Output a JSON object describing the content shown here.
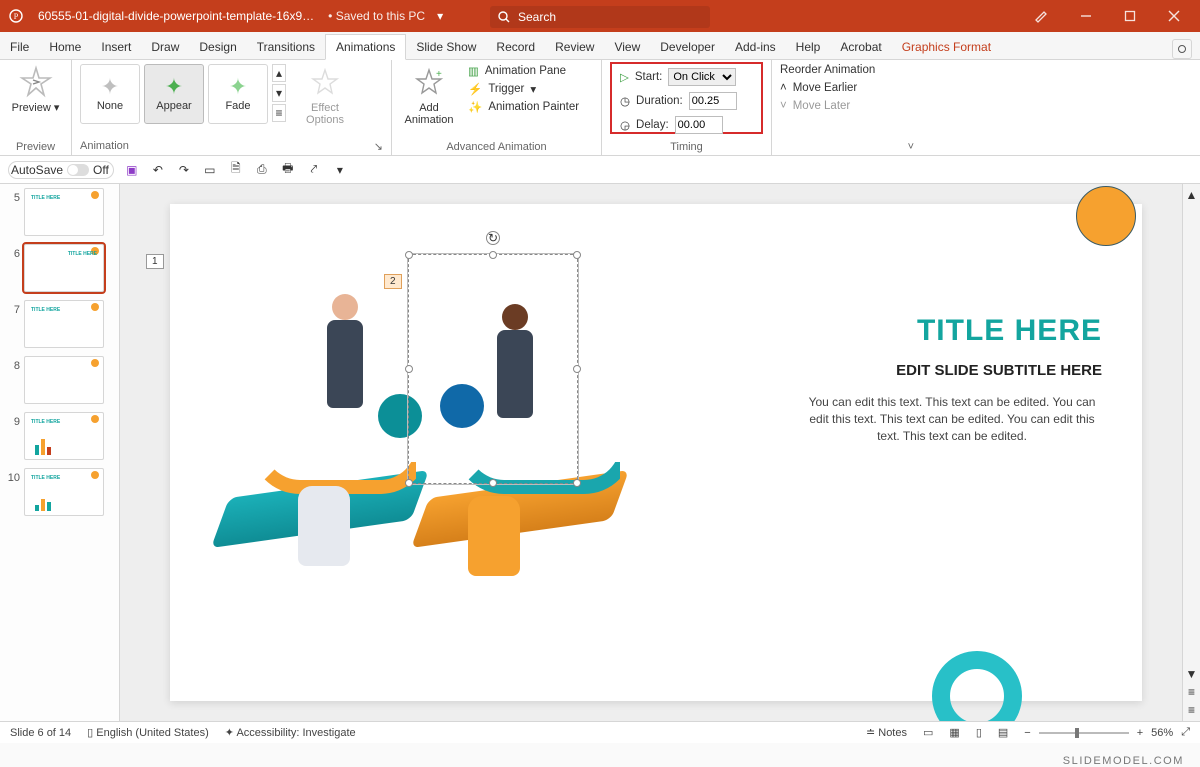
{
  "title": {
    "document": "60555-01-digital-divide-powerpoint-template-16x9…",
    "save_state": "• Saved to this PC",
    "search_placeholder": "Search"
  },
  "tabs": [
    "File",
    "Home",
    "Insert",
    "Draw",
    "Design",
    "Transitions",
    "Animations",
    "Slide Show",
    "Record",
    "Review",
    "View",
    "Developer",
    "Add-ins",
    "Help",
    "Acrobat",
    "Graphics Format"
  ],
  "tabs_active_index": 6,
  "ribbon": {
    "preview": {
      "label": "Preview",
      "group": "Preview"
    },
    "animation": {
      "group": "Animation",
      "items": [
        {
          "name": "None",
          "color": "#bfbfbf"
        },
        {
          "name": "Appear",
          "color": "#4caf50",
          "selected": true
        },
        {
          "name": "Fade",
          "color": "#4caf50"
        }
      ],
      "effect_options": "Effect\nOptions"
    },
    "advanced": {
      "group": "Advanced Animation",
      "add": "Add\nAnimation",
      "pane": "Animation Pane",
      "trigger": "Trigger",
      "painter": "Animation Painter"
    },
    "timing": {
      "group": "Timing",
      "start_label": "Start:",
      "start_value": "On Click",
      "duration_label": "Duration:",
      "duration_value": "00.25",
      "delay_label": "Delay:",
      "delay_value": "00.00"
    },
    "reorder": {
      "title": "Reorder Animation",
      "earlier": "Move Earlier",
      "later": "Move Later"
    }
  },
  "qat": {
    "autosave_label": "AutoSave",
    "autosave_state": "Off"
  },
  "thumbs": {
    "visible": [
      5,
      6,
      7,
      8,
      9,
      10
    ],
    "selected": 6,
    "has_anim": [
      6
    ]
  },
  "anim_tags": {
    "tag1": "1",
    "tag2": "2"
  },
  "slide": {
    "title": "TITLE HERE",
    "subtitle": "EDIT SLIDE SUBTITLE HERE",
    "body": "You can edit this text. This text can be edited. You can edit this text. This text can be edited. You can edit this text. This text can be edited."
  },
  "status": {
    "slide": "Slide 6 of 14",
    "lang": "English (United States)",
    "acc": "Accessibility: Investigate",
    "notes": "Notes",
    "zoom": "56%"
  },
  "watermark": "SLIDEMODEL.COM"
}
